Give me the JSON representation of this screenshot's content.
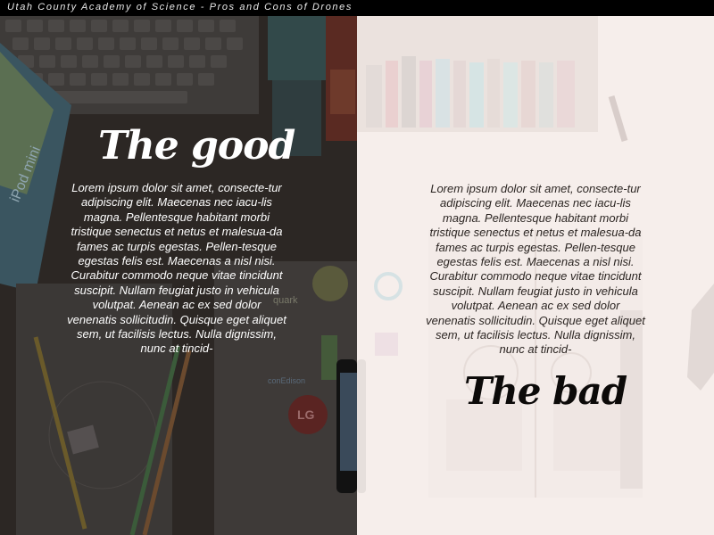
{
  "header": {
    "title": "Utah County Academy of Science - Pros and Cons of Drones"
  },
  "left_panel": {
    "heading": "The good",
    "body": "Lorem ipsum dolor sit amet, consecte-tur adipiscing elit. Maecenas nec iacu-lis magna. Pellentesque habitant morbi tristique senectus et netus et malesua-da fames ac turpis egestas. Pellen-tesque egestas felis est. Maecenas a nisl nisi. Curabitur commodo neque vitae tincidunt suscipit. Nullam feugiat justo in vehicula volutpat. Aenean ac ex sed dolor venenatis sollicitudin. Quisque eget aliquet sem, ut facilisis lectus. Nulla dignissim, nunc at tincid-",
    "photo": {
      "device_label": "iPod mini",
      "logo_labels": [
        "quark",
        "conEdison",
        "LG"
      ]
    }
  },
  "right_panel": {
    "heading": "The bad",
    "body": "Lorem ipsum dolor sit amet, consecte-tur adipiscing elit. Maecenas nec iacu-lis magna. Pellentesque habitant morbi tristique senectus et netus et malesua-da fames ac turpis egestas. Pellen-tesque egestas felis est. Maecenas a nisl nisi. Curabitur commodo neque vitae tincidunt suscipit. Nullam feugiat justo in vehicula volutpat. Aenean ac ex sed dolor venenatis sollicitudin. Quisque eget aliquet sem, ut facilisis lectus. Nulla dignissim, nunc at tincid-"
  },
  "colors": {
    "top_bar": "#000000",
    "left_overlay": "#2a2624",
    "right_overlay": "#f6eeeb",
    "good_text": "#ffffff",
    "bad_text": "#0c0a09"
  }
}
